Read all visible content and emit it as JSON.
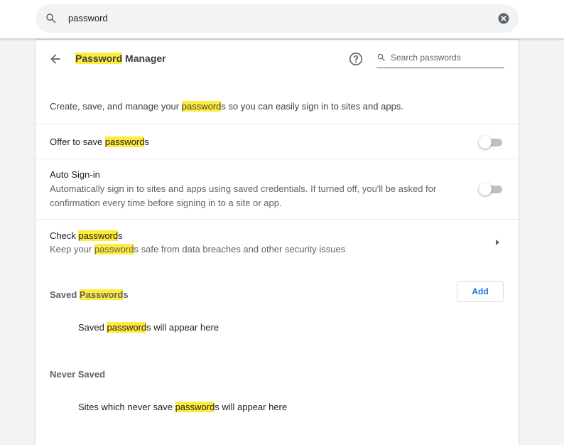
{
  "search": {
    "value": "password"
  },
  "header": {
    "title_match": "Password",
    "title_rest": " Manager",
    "search_placeholder": "Search passwords"
  },
  "description": {
    "before": "Create, save, and manage your ",
    "match": "password",
    "after": "s so you can easily sign in to sites and apps."
  },
  "offer_save": {
    "before": "Offer to save ",
    "match": "password",
    "after": "s",
    "enabled": false
  },
  "auto_signin": {
    "label": "Auto Sign-in",
    "desc_line1": "Automatically sign in to sites and apps using saved credentials. If turned off, you'll be asked for",
    "desc_line2": "confirmation every time before signing in to a site or app.",
    "enabled": false
  },
  "check": {
    "label_before": "Check ",
    "label_match": "password",
    "label_after": "s",
    "sub_before": "Keep your ",
    "sub_match": "password",
    "sub_after": "s safe from data breaches and other security issues"
  },
  "saved": {
    "heading_before": "Saved ",
    "heading_match": "Password",
    "heading_after": "s",
    "add_label": "Add",
    "empty_before": "Saved ",
    "empty_match": "password",
    "empty_after": "s will appear here"
  },
  "never_saved": {
    "heading": "Never Saved",
    "empty_before": "Sites which never save ",
    "empty_match": "password",
    "empty_after": "s will appear here"
  },
  "colors": {
    "highlight": "#ffeb3b",
    "accent": "#1a73e8"
  }
}
